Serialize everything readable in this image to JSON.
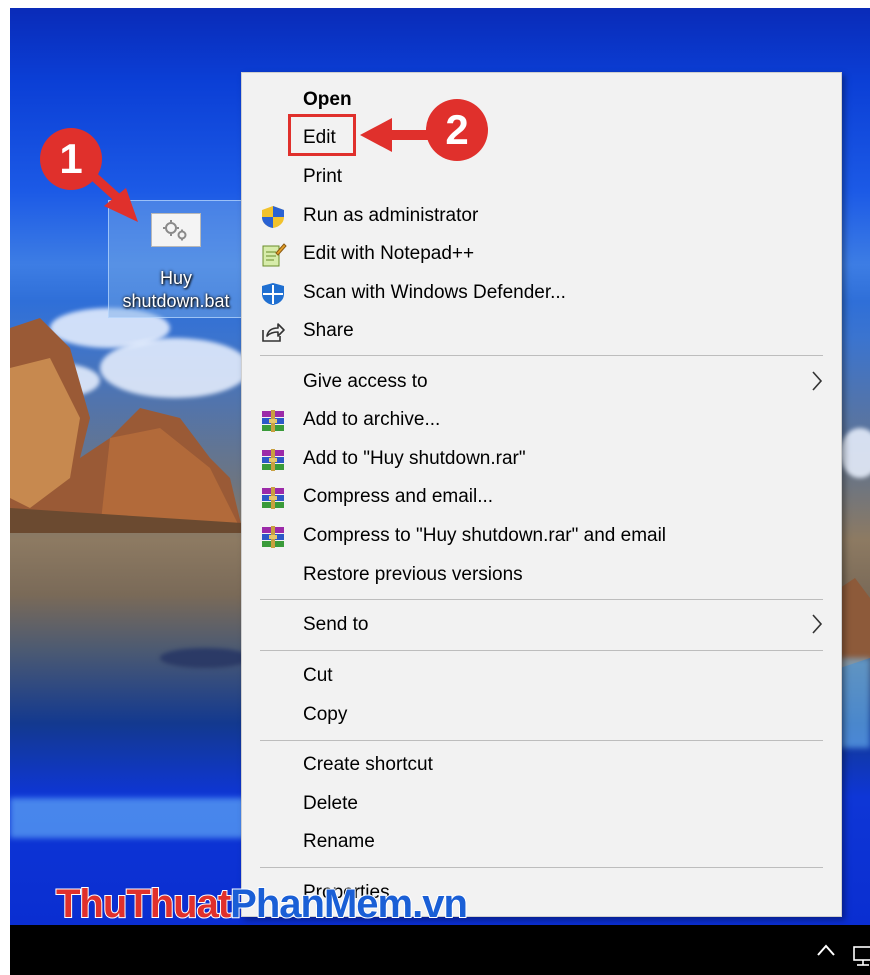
{
  "desktop": {
    "icon_label": "Huy\nshutdown.bat",
    "icon_name": "batch-file-gear-icon"
  },
  "context_menu": {
    "items": [
      {
        "label": "Open",
        "bold": true,
        "icon": null
      },
      {
        "label": "Edit",
        "icon": null,
        "highlighted": true
      },
      {
        "label": "Print",
        "icon": null
      },
      {
        "label": "Run as administrator",
        "icon": "uac-shield-icon"
      },
      {
        "label": "Edit with Notepad++",
        "icon": "notepad-plus-plus-icon"
      },
      {
        "label": "Scan with Windows Defender...",
        "icon": "windows-defender-icon"
      },
      {
        "label": "Share",
        "icon": "share-icon"
      },
      {
        "label": "Give access to",
        "icon": null,
        "submenu": true
      },
      {
        "label": "Add to archive...",
        "icon": "winrar-icon"
      },
      {
        "label": "Add to \"Huy shutdown.rar\"",
        "icon": "winrar-icon"
      },
      {
        "label": "Compress and email...",
        "icon": "winrar-icon"
      },
      {
        "label": "Compress to \"Huy shutdown.rar\" and email",
        "icon": "winrar-icon"
      },
      {
        "label": "Restore previous versions",
        "icon": null
      },
      {
        "label": "Send to",
        "icon": null,
        "submenu": true
      },
      {
        "label": "Cut",
        "icon": null
      },
      {
        "label": "Copy",
        "icon": null
      },
      {
        "label": "Create shortcut",
        "icon": null
      },
      {
        "label": "Delete",
        "icon": null
      },
      {
        "label": "Rename",
        "icon": null
      },
      {
        "label": "Properties",
        "icon": null
      }
    ]
  },
  "annotations": {
    "step1": "1",
    "step2": "2",
    "color": "#e0302c"
  },
  "watermark": {
    "part1": "ThuThuat",
    "part2": "PhanMem.vn"
  },
  "taskbar": {
    "tray_icons": [
      "chevron-up-icon",
      "network-icon"
    ]
  }
}
